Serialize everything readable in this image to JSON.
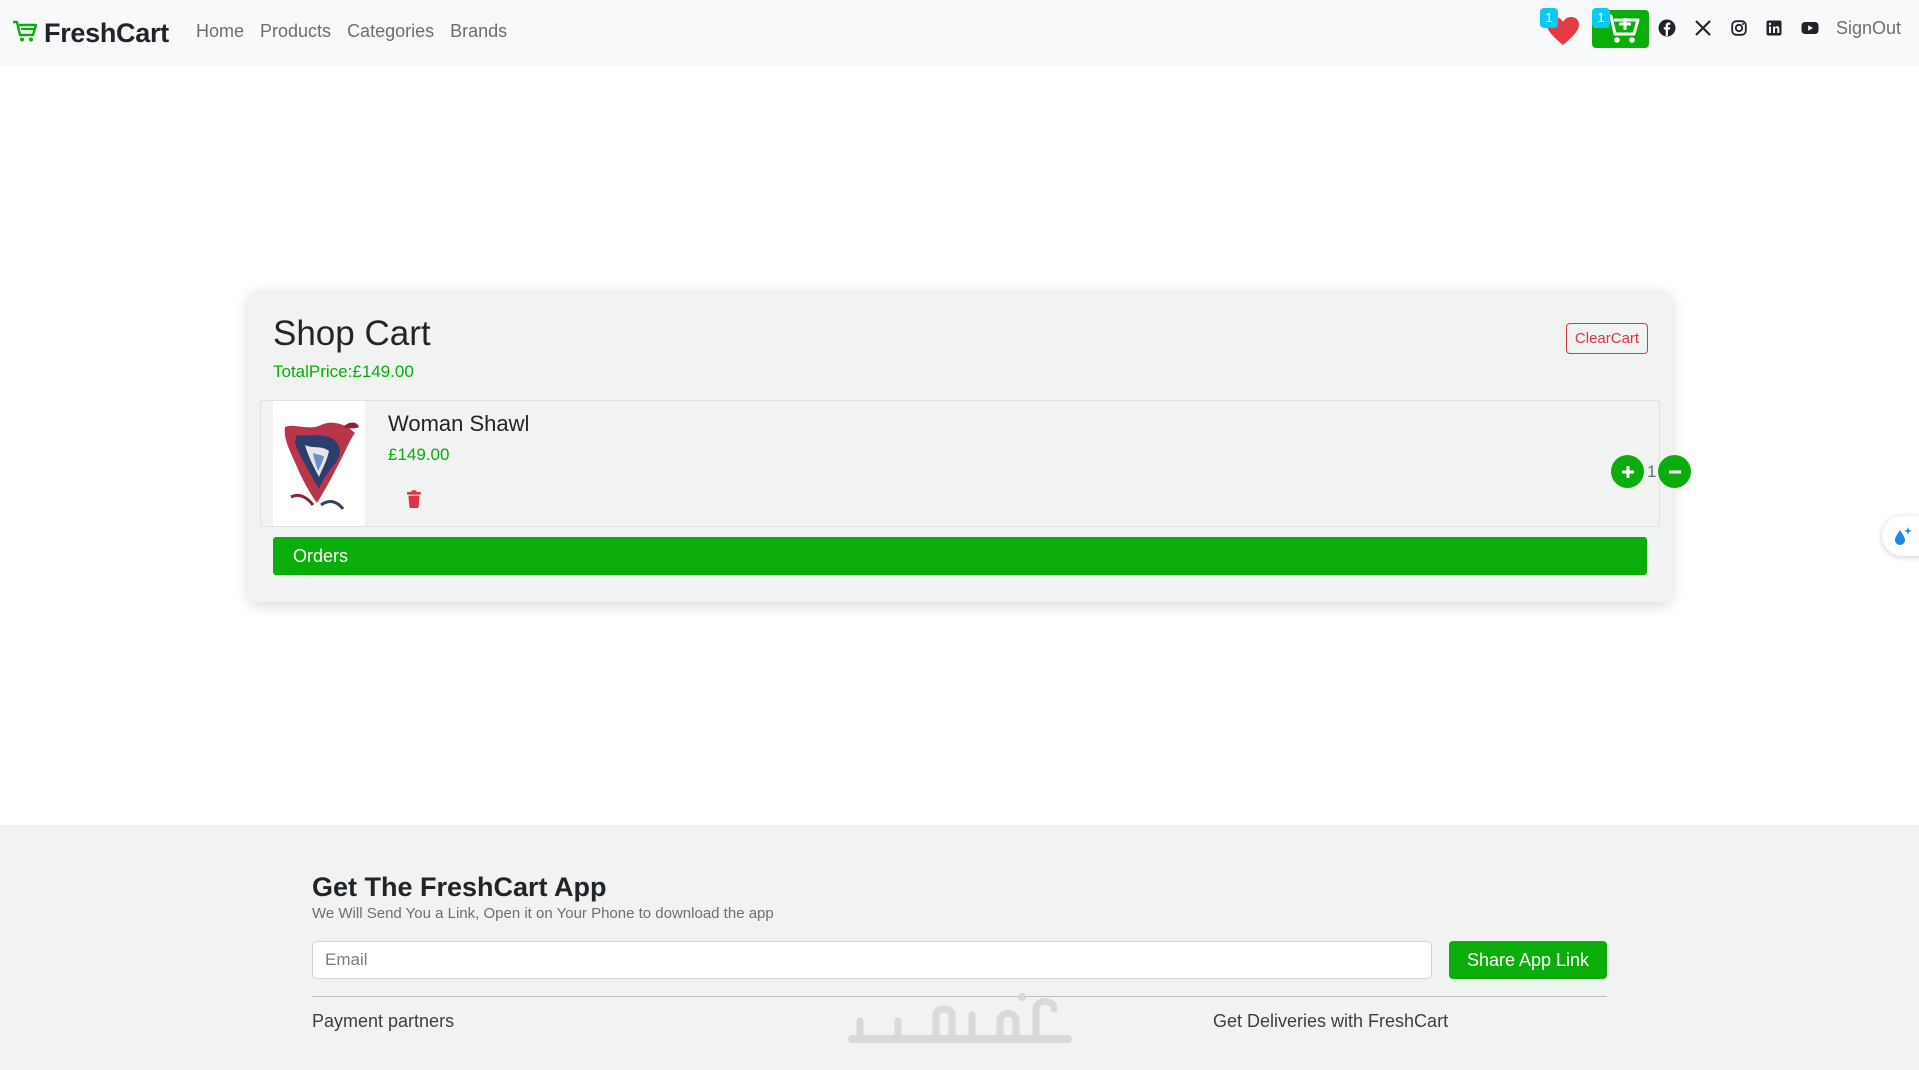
{
  "navbar": {
    "brand": "FreshCart",
    "links": [
      "Home",
      "Products",
      "Categories",
      "Brands"
    ],
    "wishlist_count": "1",
    "cart_count": "1",
    "social_icons": [
      "facebook-icon",
      "x-twitter-icon",
      "instagram-icon",
      "linkedin-icon",
      "youtube-icon"
    ],
    "signout": "SignOut"
  },
  "cart": {
    "title": "Shop Cart",
    "total_price": "TotalPrice:£149.00",
    "clear_label": "ClearCart",
    "items": [
      {
        "name": "Woman Shawl",
        "price": "£149.00",
        "quantity": "1"
      }
    ],
    "orders_label": "Orders"
  },
  "footer": {
    "title": "Get The FreshCart App",
    "subtitle": "We Will Send You a Link, Open it on Your Phone to download the app",
    "email_placeholder": "Email",
    "share_label": "Share App Link",
    "payment_label": "Payment partners",
    "deliveries_label": "Get Deliveries with FreshCart",
    "watermark": "خمسات"
  },
  "colors": {
    "brand_green": "#0aad0a",
    "danger": "#dc3545",
    "badge": "#0dcaf0",
    "heart": "#e63946"
  }
}
